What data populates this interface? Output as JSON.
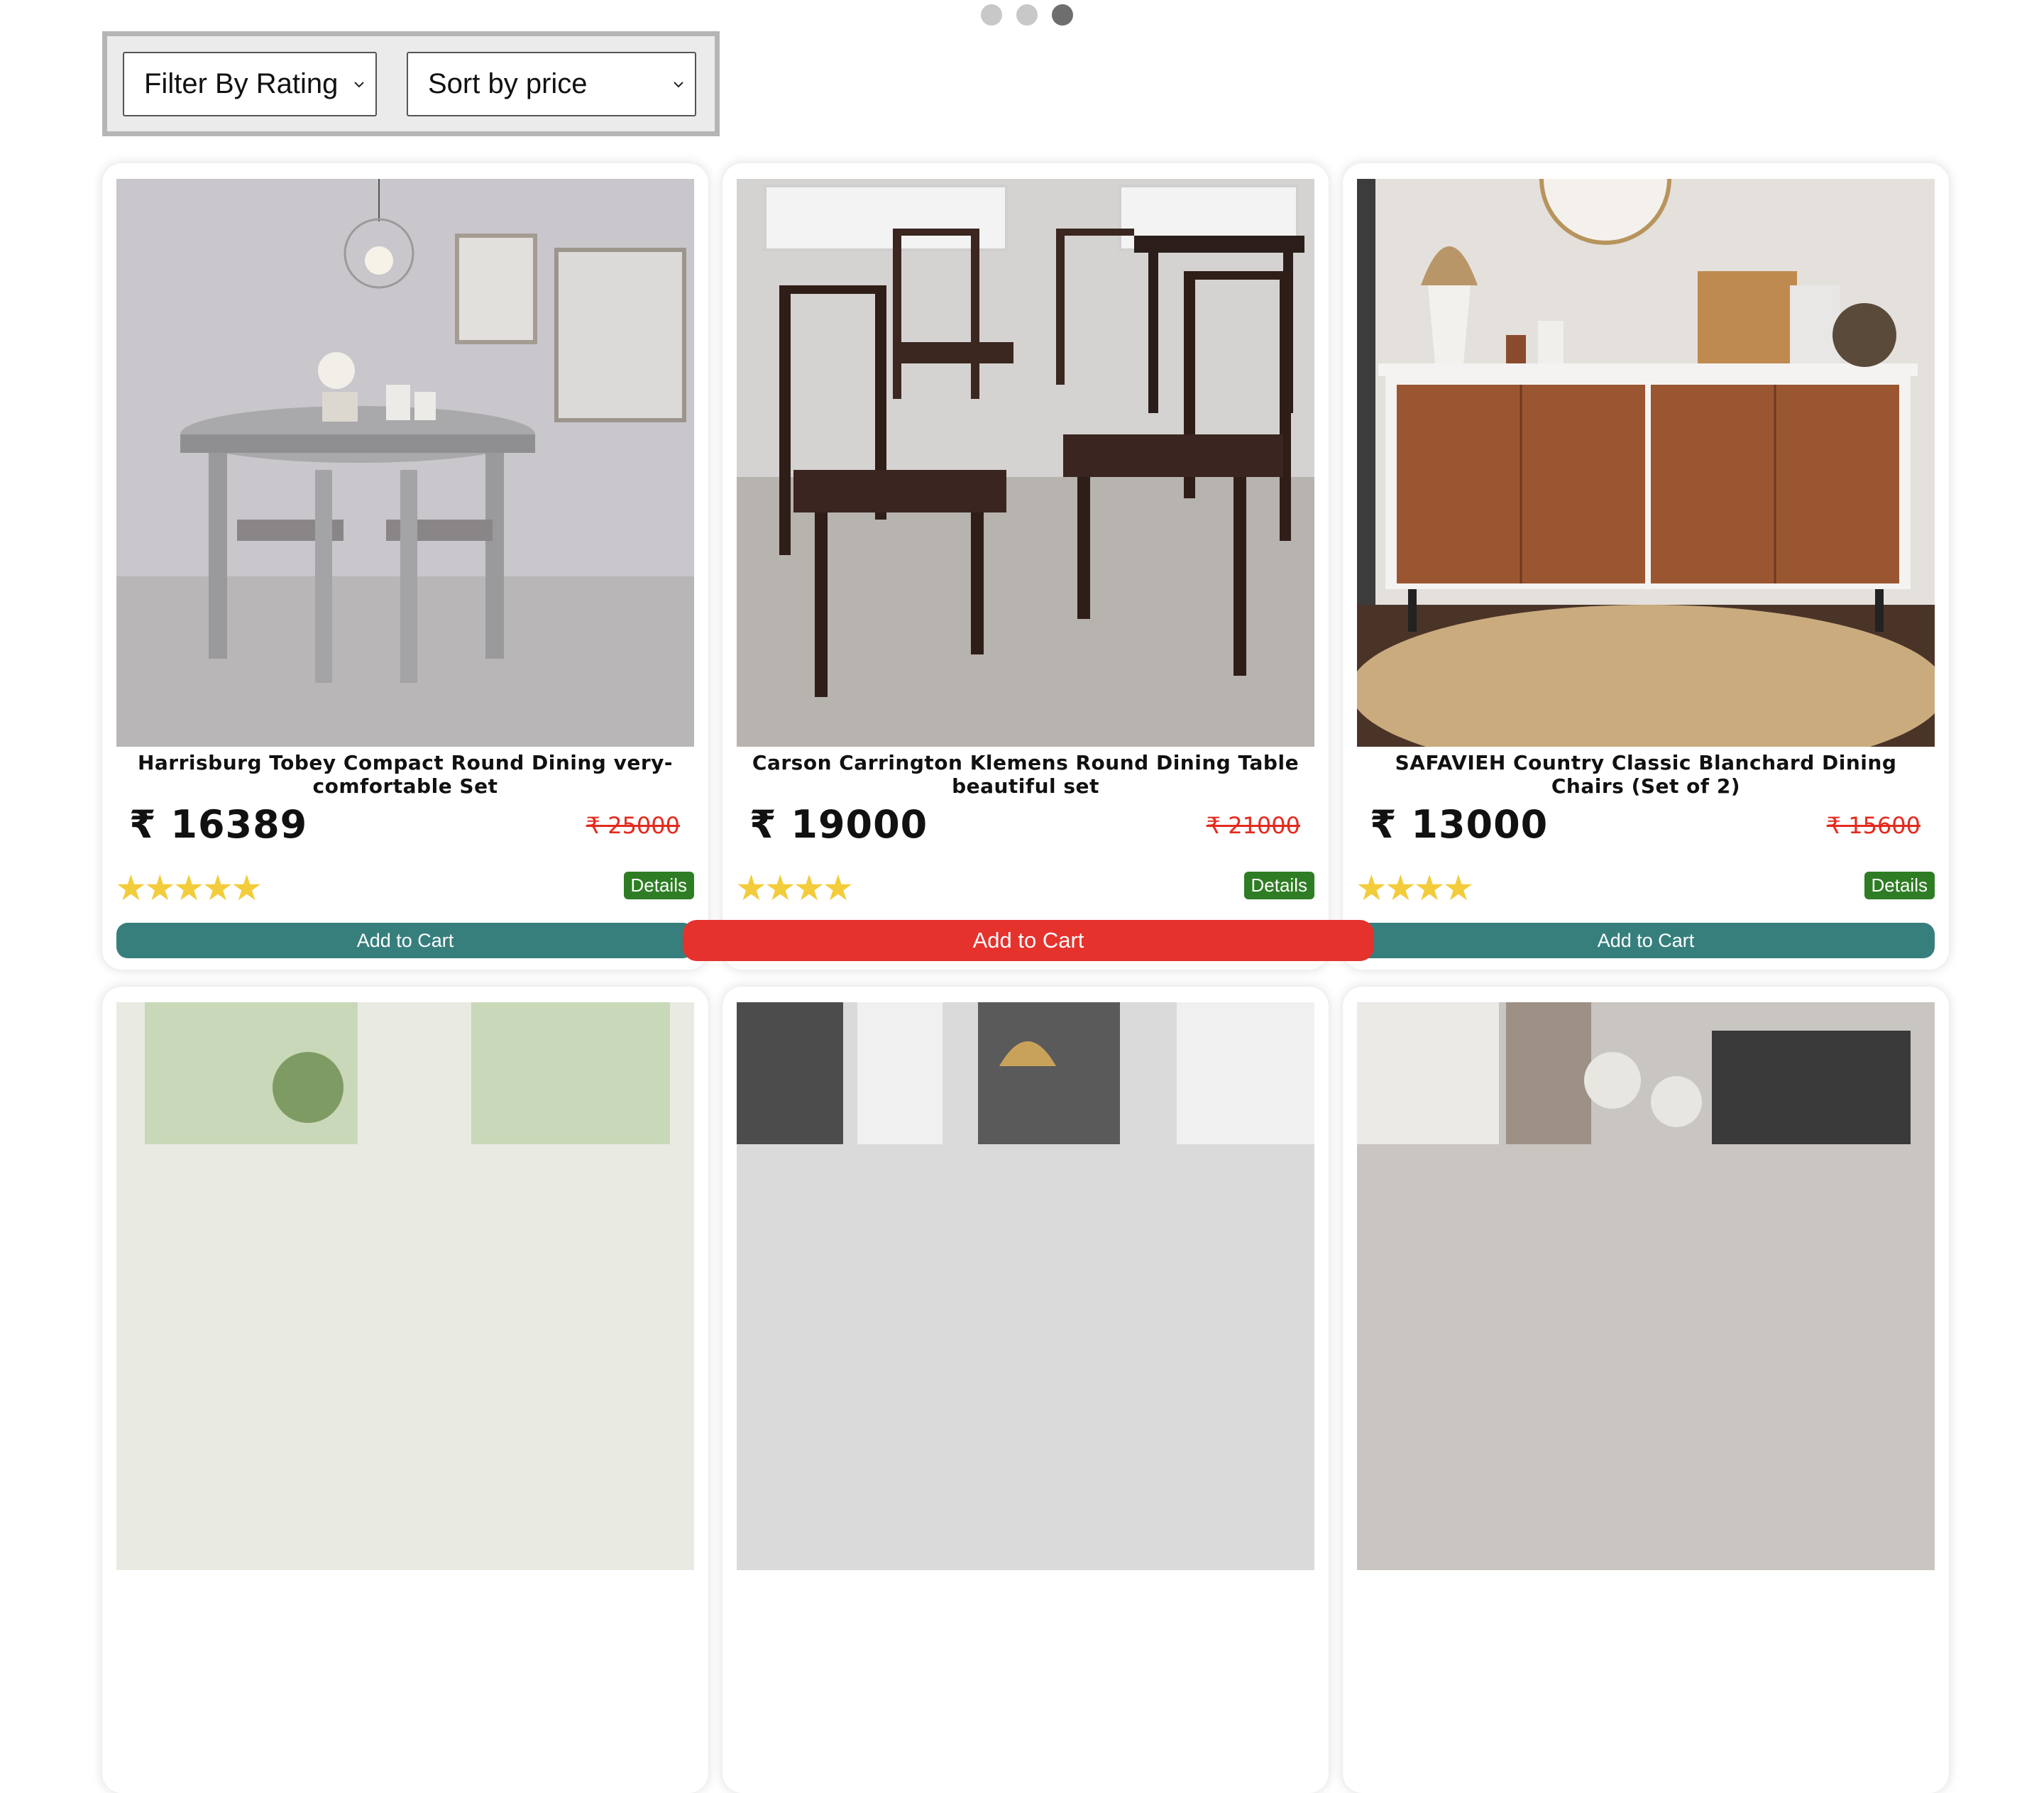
{
  "carousel": {
    "dots": 3,
    "active_index": 2
  },
  "filters": {
    "rating_label": "Filter By Rating",
    "price_label": "Sort by price"
  },
  "products": [
    {
      "title": "Harrisburg Tobey Compact Round Dining very-comfortable Set",
      "price": "₹ 16389",
      "mrp": "₹ 25000",
      "rating": 5,
      "stars": "★★★★★",
      "details_label": "Details",
      "cart_label": "Add to Cart"
    },
    {
      "title": "Carson Carrington Klemens Round Dining Table beautiful set",
      "price": "₹ 19000",
      "mrp": "₹ 21000",
      "rating": 4,
      "stars": "★★★★",
      "details_label": "Details",
      "cart_label": "Add to Cart"
    },
    {
      "title": "SAFAVIEH Country Classic Blanchard Dining Chairs (Set of 2)",
      "price": "₹ 13000",
      "mrp": "₹ 15600",
      "rating": 4,
      "stars": "★★★★",
      "details_label": "Details",
      "cart_label": "Add to Cart"
    }
  ],
  "colors": {
    "cart_button": "#377f7d",
    "cart_button_hover": "#e5322d",
    "details_badge": "#2e7d24",
    "star": "#f2cc3a",
    "mrp_strike": "#e32b1f"
  }
}
